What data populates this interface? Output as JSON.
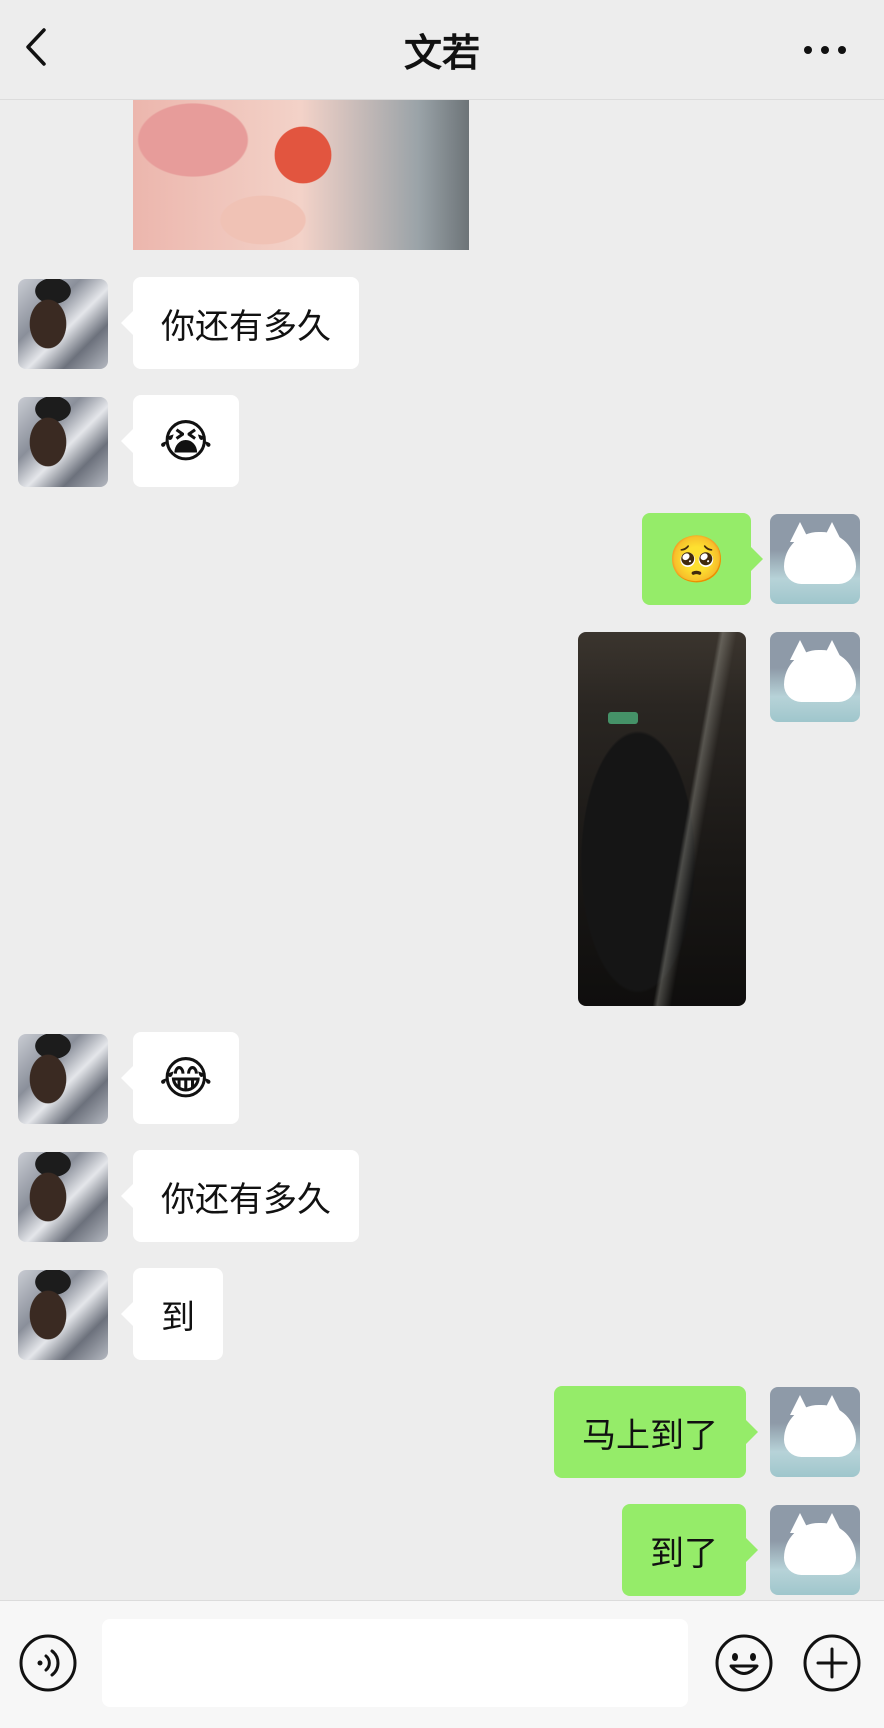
{
  "header": {
    "title": "文若",
    "back_icon": "chevron-left-icon",
    "more_icon": "more-dots-icon"
  },
  "messages": [
    {
      "from": "contact",
      "type": "image",
      "description_icon": "photo-icon"
    },
    {
      "from": "contact",
      "type": "text",
      "text": "你还有多久"
    },
    {
      "from": "contact",
      "type": "emoji",
      "text": "😭"
    },
    {
      "from": "me",
      "type": "emoji",
      "text": "🥺"
    },
    {
      "from": "me",
      "type": "video"
    },
    {
      "from": "contact",
      "type": "emoji",
      "text": "😂"
    },
    {
      "from": "contact",
      "type": "text",
      "text": "你还有多久"
    },
    {
      "from": "contact",
      "type": "text",
      "text": "到"
    },
    {
      "from": "me",
      "type": "text",
      "text": "马上到了"
    },
    {
      "from": "me",
      "type": "text",
      "text": "到了"
    }
  ],
  "footer": {
    "input_placeholder": "",
    "voice_icon": "voice-icon",
    "emoji_icon": "emoji-icon",
    "plus_icon": "plus-icon"
  },
  "colors": {
    "background": "#ededed",
    "bubble_out": "#95ec69",
    "bubble_in": "#ffffff"
  }
}
